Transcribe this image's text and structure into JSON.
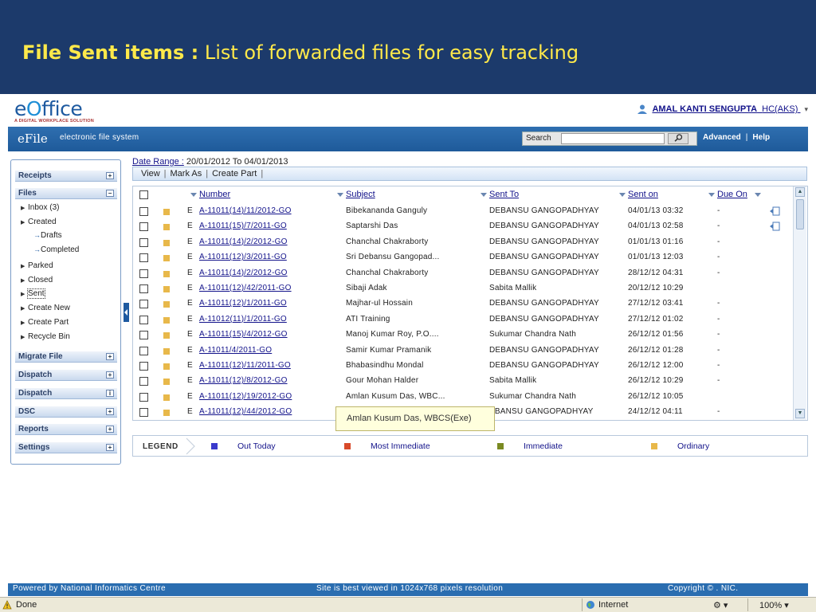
{
  "banner": {
    "title_bold": "File Sent items :",
    "title_rest": "List of forwarded files for easy tracking"
  },
  "logo": {
    "text_pre": "e",
    "text_o": "O",
    "text_post": "ffice",
    "tagline": "A DIGITAL WORKPLACE SOLUTION"
  },
  "user": {
    "name": "AMAL KANTI SENGUPTA",
    "role": "HC(AKS)"
  },
  "appbar": {
    "title": "eFile",
    "subtitle": "electronic file system",
    "search_label": "Search",
    "search_value": "",
    "advanced": "Advanced",
    "separator": "|",
    "help": "Help"
  },
  "sidebar": {
    "receipts": "Receipts",
    "files": "Files",
    "inbox": "Inbox (3)",
    "created": "Created",
    "drafts": "Drafts",
    "completed": "Completed",
    "parked": "Parked",
    "closed": "Closed",
    "sent": "Sent",
    "create_new": "Create New",
    "create_part": "Create Part",
    "recycle_bin": "Recycle Bin",
    "migrate_file": "Migrate File",
    "dispatch": "Dispatch",
    "dispatch2": "Dispatch",
    "dsc": "DSC",
    "reports": "Reports",
    "settings": "Settings"
  },
  "daterange": {
    "label": "Date Range :",
    "value": "20/01/2012 To 04/01/2013"
  },
  "toolbar": {
    "view": "View",
    "mark_as": "Mark As",
    "create_part": "Create Part",
    "sep": "|"
  },
  "columns": {
    "number": "Number",
    "subject": "Subject",
    "sent_to": "Sent To",
    "sent_on": "Sent on",
    "due_on": "Due On"
  },
  "rows": [
    {
      "type": "E",
      "number": "A-11011(14)/11/2012-GO",
      "subject": "Bibekananda Ganguly",
      "sent_to": "DEBANSU GANGOPADHYAY",
      "sent_on": "04/01/13 03:32",
      "due": "-",
      "track": true
    },
    {
      "type": "E",
      "number": "A-11011(15)/7/2011-GO",
      "subject": "Saptarshi Das",
      "sent_to": "DEBANSU GANGOPADHYAY",
      "sent_on": "04/01/13 02:58",
      "due": "-",
      "track": true
    },
    {
      "type": "E",
      "number": "A-11011(14)/2/2012-GO",
      "subject": "Chanchal Chakraborty",
      "sent_to": "DEBANSU GANGOPADHYAY",
      "sent_on": "01/01/13 01:16",
      "due": "-",
      "track": false
    },
    {
      "type": "E",
      "number": "A-11011(12)/3/2011-GO",
      "subject": "Sri Debansu Gangopad...",
      "sent_to": "DEBANSU GANGOPADHYAY",
      "sent_on": "01/01/13 12:03",
      "due": "-",
      "track": false
    },
    {
      "type": "E",
      "number": "A-11011(14)/2/2012-GO",
      "subject": "Chanchal Chakraborty",
      "sent_to": "DEBANSU GANGOPADHYAY",
      "sent_on": "28/12/12 04:31",
      "due": "-",
      "track": false
    },
    {
      "type": "E",
      "number": "A-11011(12)/42/2011-GO",
      "subject": "Sibaji Adak",
      "sent_to": "Sabita Mallik",
      "sent_on": "20/12/12 10:29",
      "due": "",
      "track": false
    },
    {
      "type": "E",
      "number": "A-11011(12)/1/2011-GO",
      "subject": "Majhar-ul Hossain",
      "sent_to": "DEBANSU GANGOPADHYAY",
      "sent_on": "27/12/12 03:41",
      "due": "-",
      "track": false
    },
    {
      "type": "E",
      "number": "A-11012(11)/1/2011-GO",
      "subject": "ATI Training",
      "sent_to": "DEBANSU GANGOPADHYAY",
      "sent_on": "27/12/12 01:02",
      "due": "-",
      "track": false
    },
    {
      "type": "E",
      "number": "A-11011(15)/4/2012-GO",
      "subject": "Manoj Kumar Roy, P.O....",
      "sent_to": "Sukumar Chandra Nath",
      "sent_on": "26/12/12 01:56",
      "due": "-",
      "track": false
    },
    {
      "type": "E",
      "number": "A-11011/4/2011-GO",
      "subject": "Samir Kumar Pramanik",
      "sent_to": "DEBANSU GANGOPADHYAY",
      "sent_on": "26/12/12 01:28",
      "due": "-",
      "track": false
    },
    {
      "type": "E",
      "number": "A-11011(12)/11/2011-GO",
      "subject": "Bhabasindhu Mondal",
      "sent_to": "DEBANSU GANGOPADHYAY",
      "sent_on": "26/12/12 12:00",
      "due": "-",
      "track": false
    },
    {
      "type": "E",
      "number": "A-11011(12)/8/2012-GO",
      "subject": "Gour Mohan Halder",
      "sent_to": "Sabita Mallik",
      "sent_on": "26/12/12 10:29",
      "due": "-",
      "track": false
    },
    {
      "type": "E",
      "number": "A-11011(12)/19/2012-GO",
      "subject": "Amlan Kusum Das, WBC...",
      "sent_to": "Sukumar Chandra Nath",
      "sent_on": "26/12/12 10:05",
      "due": "",
      "track": false
    },
    {
      "type": "E",
      "number": "A-11011(12)/44/2012-GO",
      "subject": "",
      "sent_to": "EBANSU GANGOPADHYAY",
      "sent_on": "24/12/12 04:11",
      "due": "-",
      "track": false
    }
  ],
  "tooltip": "Amlan Kusum Das, WBCS(Exe)",
  "legend": {
    "title": "LEGEND",
    "items": [
      {
        "label": "Out Today",
        "color": "#3a3acc"
      },
      {
        "label": "Most Immediate",
        "color": "#d84a2a"
      },
      {
        "label": "Immediate",
        "color": "#7a8a22"
      },
      {
        "label": "Ordinary",
        "color": "#e8b84a"
      }
    ]
  },
  "footer": {
    "left": "Powered by National Informatics Centre",
    "center": "Site is best viewed in 1024x768 pixels resolution",
    "right": "Copyright © . NIC."
  },
  "statusbar": {
    "done": "Done",
    "zone": "Internet",
    "zoom": "100%"
  },
  "colors": {
    "banner": "#1c3a6b",
    "banner_text": "#ffe94a",
    "appbar": "#2a6db0",
    "link": "#12128a",
    "ordinary": "#e8b84a"
  }
}
